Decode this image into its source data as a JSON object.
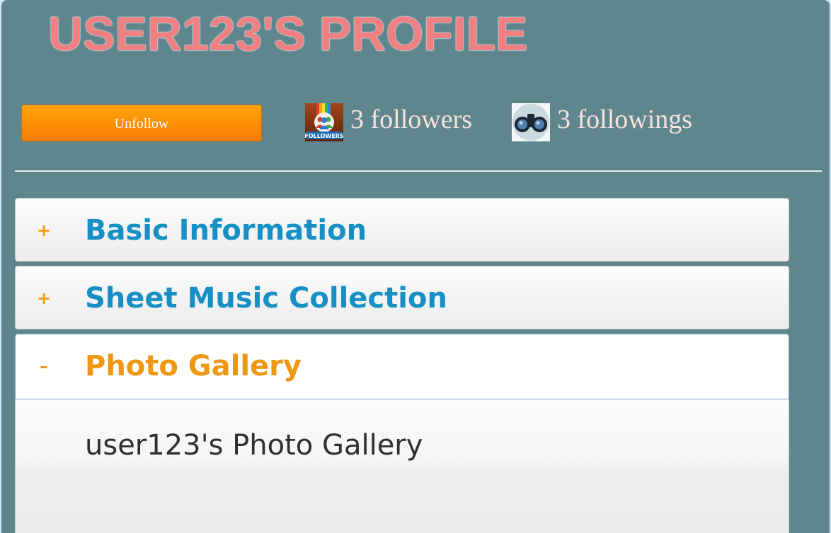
{
  "profile": {
    "title": "USER123'S PROFILE"
  },
  "actions": {
    "follow_button_label": "Unfollow"
  },
  "stats": {
    "followers_icon": "followers-badge-icon",
    "followers_text": "3 followers",
    "followings_icon": "binoculars-icon",
    "followings_text": "3 followings"
  },
  "accordion": {
    "sections": [
      {
        "sign": "+",
        "label": "Basic Information",
        "expanded": false
      },
      {
        "sign": "+",
        "label": "Sheet Music Collection",
        "expanded": false
      },
      {
        "sign": "–",
        "label": "Photo Gallery",
        "expanded": true
      }
    ],
    "panel_text": "user123's Photo Gallery"
  },
  "colors": {
    "background": "#5f868d",
    "title": "#f07f82",
    "button": "#f98f07",
    "section_title": "#1690c4",
    "active_section_title": "#ed9712",
    "stat_text": "#f6e2dc"
  }
}
